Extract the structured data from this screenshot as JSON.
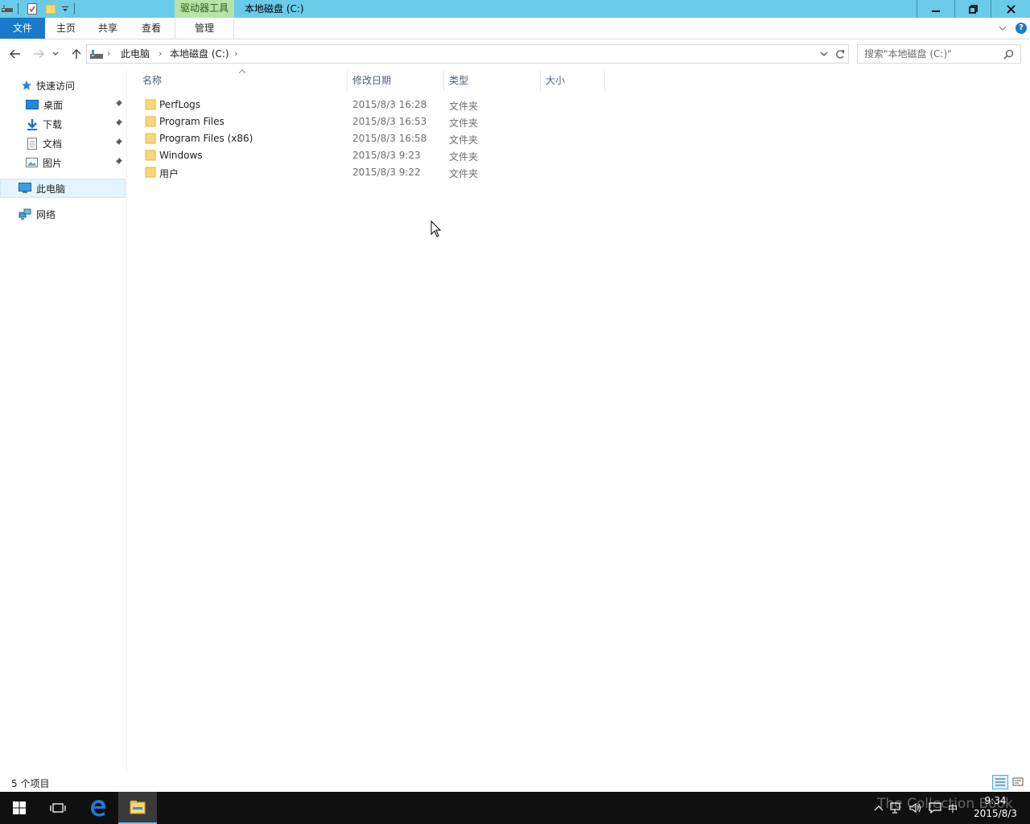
{
  "window": {
    "title": "本地磁盘 (C:)",
    "context_tab_group": "驱动器工具",
    "controls": {
      "minimize": "minimize",
      "maximize": "restore",
      "close": "close"
    }
  },
  "ribbon": {
    "tabs": [
      {
        "label": "文件",
        "active": true
      },
      {
        "label": "主页"
      },
      {
        "label": "共享"
      },
      {
        "label": "查看"
      },
      {
        "label": "管理"
      }
    ],
    "help": "?"
  },
  "address": {
    "crumbs": [
      "此电脑",
      "本地磁盘 (C:)"
    ]
  },
  "search": {
    "placeholder": "搜索\"本地磁盘 (C:)\""
  },
  "navpane": {
    "quick_access": "快速访问",
    "items": [
      {
        "label": "桌面",
        "icon": "desktop-icon",
        "pinned": true
      },
      {
        "label": "下载",
        "icon": "download-icon",
        "pinned": true
      },
      {
        "label": "文档",
        "icon": "document-icon",
        "pinned": true
      },
      {
        "label": "图片",
        "icon": "picture-icon",
        "pinned": true
      }
    ],
    "this_pc": "此电脑",
    "network": "网络"
  },
  "columns": {
    "name": "名称",
    "date": "修改日期",
    "type": "类型",
    "size": "大小"
  },
  "files": [
    {
      "name": "PerfLogs",
      "date": "2015/8/3 16:28",
      "type": "文件夹"
    },
    {
      "name": "Program Files",
      "date": "2015/8/3 16:53",
      "type": "文件夹"
    },
    {
      "name": "Program Files (x86)",
      "date": "2015/8/3 16:58",
      "type": "文件夹"
    },
    {
      "name": "Windows",
      "date": "2015/8/3 9:23",
      "type": "文件夹"
    },
    {
      "name": "用户",
      "date": "2015/8/3 9:22",
      "type": "文件夹"
    }
  ],
  "status": {
    "count": "5 个项目"
  },
  "taskbar": {
    "clock_time": "9:34",
    "clock_date": "2015/8/3",
    "ime": "中",
    "watermark": "The Collection Book"
  },
  "colors": {
    "titlebar": "#6acbe9",
    "file_tab": "#1979ca",
    "context_tab": "#b8e2a6",
    "folder": "#f8d775",
    "taskbar": "#101010"
  }
}
